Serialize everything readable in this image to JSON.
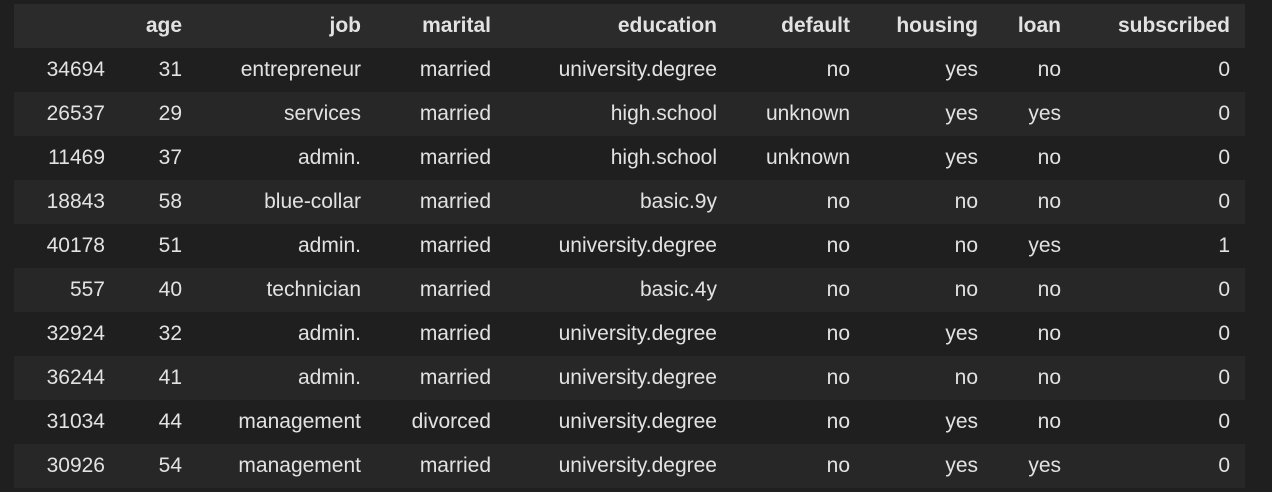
{
  "columns": [
    "",
    "age",
    "job",
    "marital",
    "education",
    "default",
    "housing",
    "loan",
    "subscribed"
  ],
  "rows": [
    [
      "34694",
      "31",
      "entrepreneur",
      "married",
      "university.degree",
      "no",
      "yes",
      "no",
      "0"
    ],
    [
      "26537",
      "29",
      "services",
      "married",
      "high.school",
      "unknown",
      "yes",
      "yes",
      "0"
    ],
    [
      "11469",
      "37",
      "admin.",
      "married",
      "high.school",
      "unknown",
      "yes",
      "no",
      "0"
    ],
    [
      "18843",
      "58",
      "blue-collar",
      "married",
      "basic.9y",
      "no",
      "no",
      "no",
      "0"
    ],
    [
      "40178",
      "51",
      "admin.",
      "married",
      "university.degree",
      "no",
      "no",
      "yes",
      "1"
    ],
    [
      "557",
      "40",
      "technician",
      "married",
      "basic.4y",
      "no",
      "no",
      "no",
      "0"
    ],
    [
      "32924",
      "32",
      "admin.",
      "married",
      "university.degree",
      "no",
      "yes",
      "no",
      "0"
    ],
    [
      "36244",
      "41",
      "admin.",
      "married",
      "university.degree",
      "no",
      "no",
      "no",
      "0"
    ],
    [
      "31034",
      "44",
      "management",
      "divorced",
      "university.degree",
      "no",
      "yes",
      "no",
      "0"
    ],
    [
      "30926",
      "54",
      "management",
      "married",
      "university.degree",
      "no",
      "yes",
      "yes",
      "0"
    ]
  ]
}
